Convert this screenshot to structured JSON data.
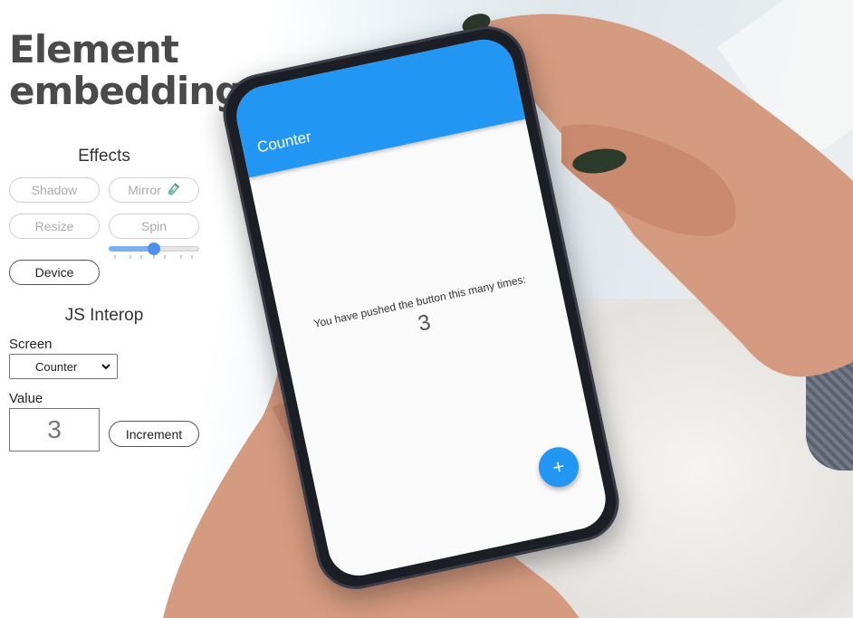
{
  "page": {
    "title_line1": "Element",
    "title_line2": "embedding"
  },
  "effects": {
    "heading": "Effects",
    "shadow_label": "Shadow",
    "mirror_label": "Mirror",
    "resize_label": "Resize",
    "spin_label": "Spin",
    "device_label": "Device",
    "mirror_icon": "test-tube-icon",
    "slider_value": 0.5
  },
  "interop": {
    "heading": "JS Interop",
    "screen_label": "Screen",
    "screen_selected": "Counter",
    "value_label": "Value",
    "value": "3",
    "increment_label": "Increment"
  },
  "app": {
    "appbar_title": "Counter",
    "message": "You have pushed the button this many times:",
    "count": "3",
    "fab_label": "+",
    "primary_color": "#2196f3"
  }
}
